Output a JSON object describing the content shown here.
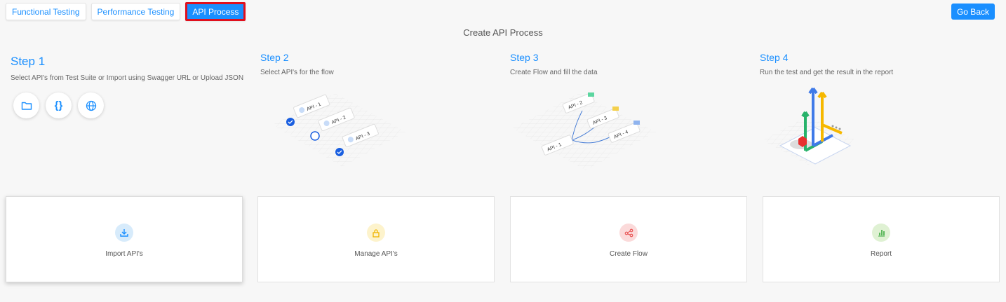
{
  "tabs": [
    {
      "label": "Functional Testing",
      "active": false
    },
    {
      "label": "Performance Testing",
      "active": false
    },
    {
      "label": "API Process",
      "active": true
    }
  ],
  "go_back_label": "Go Back",
  "page_title": "Create API Process",
  "steps": [
    {
      "title": "Step 1",
      "desc": "Select API's from Test Suite or Import using Swagger URL or Upload JSON"
    },
    {
      "title": "Step 2",
      "desc": "Select API's for the flow"
    },
    {
      "title": "Step 3",
      "desc": "Create Flow and fill the data"
    },
    {
      "title": "Step 4",
      "desc": "Run the test and get the result in the report"
    }
  ],
  "import_icons": [
    "folder-icon",
    "braces-icon",
    "globe-icon"
  ],
  "braces_glyph": "{}",
  "step2_illus": [
    "API - 1",
    "API - 2",
    "API - 3"
  ],
  "step3_illus": [
    "API - 2",
    "API - 3",
    "API - 4",
    "API - 1"
  ],
  "cards": [
    {
      "label": "Import API's",
      "icon": "download-icon",
      "color": "#1a8fff",
      "bg": "#d7ebfb"
    },
    {
      "label": "Manage API's",
      "icon": "lock-icon",
      "color": "#f0b400",
      "bg": "#fdf3cc"
    },
    {
      "label": "Create Flow",
      "icon": "share-icon",
      "color": "#e85050",
      "bg": "#fbdada"
    },
    {
      "label": "Report",
      "icon": "bar-chart-icon",
      "color": "#5cb85c",
      "bg": "#dff1d3"
    }
  ],
  "colors": {
    "accent": "#1a8fff",
    "highlight_border": "#e0101e"
  }
}
